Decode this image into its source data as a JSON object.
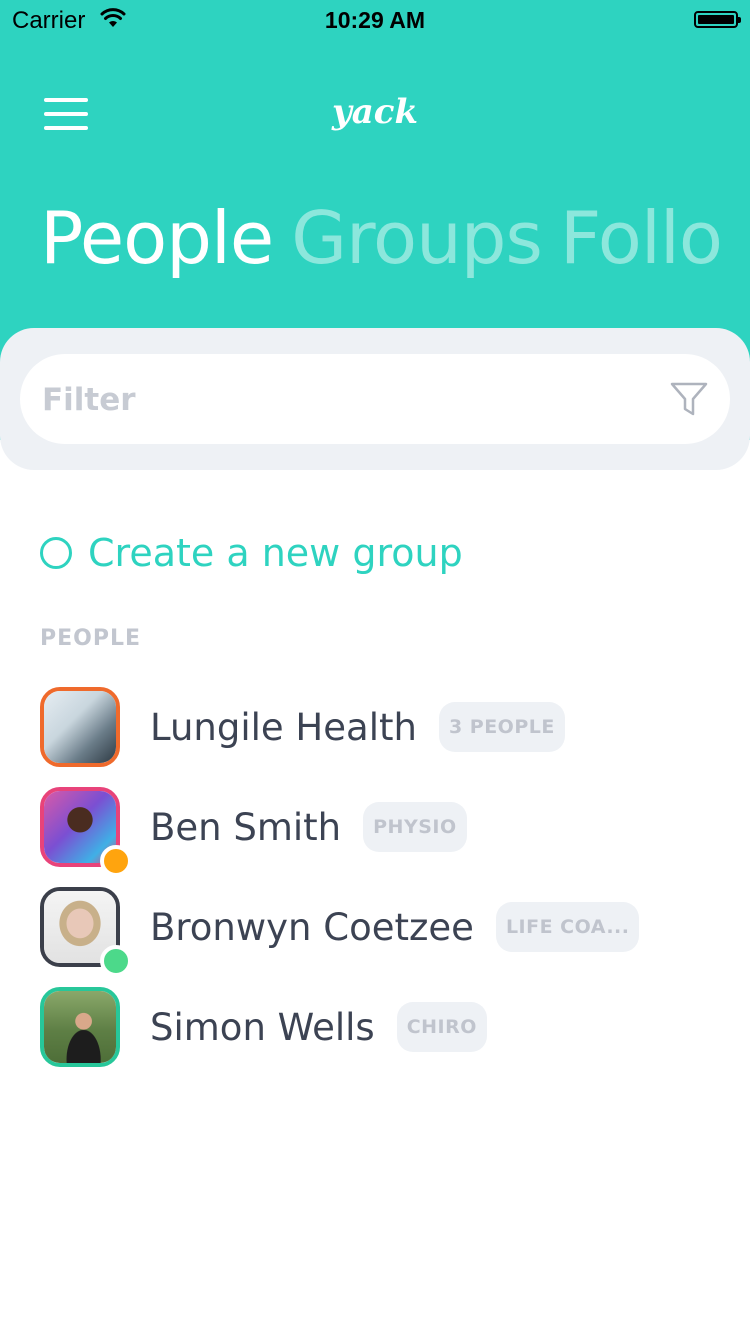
{
  "status_bar": {
    "carrier": "Carrier",
    "time": "10:29 AM"
  },
  "header": {
    "logo": "yack",
    "tabs": [
      {
        "label": "People",
        "active": true
      },
      {
        "label": "Groups",
        "active": false
      },
      {
        "label": "Follo",
        "active": false
      }
    ],
    "color": "#2ed3c0"
  },
  "filter": {
    "placeholder": "Filter",
    "value": ""
  },
  "create_group": {
    "label": "Create a new group"
  },
  "people_section": {
    "label": "PEOPLE",
    "items": [
      {
        "name": "Lungile Health",
        "tag": "3 PEOPLE",
        "border_color": "#ef6a2c",
        "presence": null
      },
      {
        "name": "Ben Smith",
        "tag": "PHYSIO",
        "border_color": "#e8437a",
        "presence": "#ffa40e"
      },
      {
        "name": "Bronwyn Coetzee",
        "tag": "LIFE COA...",
        "border_color": "#3b3f4a",
        "presence": "#4cd98a"
      },
      {
        "name": "Simon Wells",
        "tag": "CHIRO",
        "border_color": "#27c79a",
        "presence": null
      }
    ]
  }
}
